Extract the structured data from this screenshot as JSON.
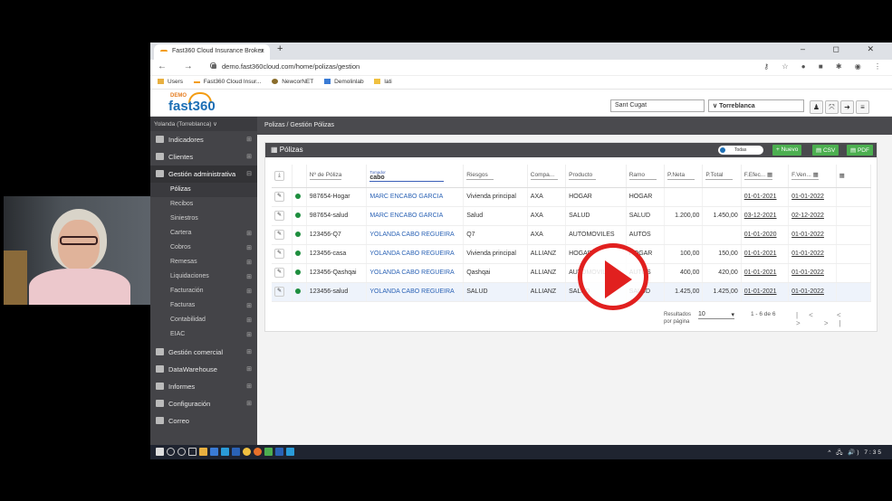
{
  "browser": {
    "tab_title": "Fast360 Cloud Insurance Broker",
    "tab_close": "×",
    "new_tab": "+",
    "window_controls": "– ◻ ✕",
    "nav": "← → C",
    "url": "demo.fast360cloud.com/home/polizas/gestion",
    "icons": "⚷ ☆ ● ■ ✱ ◉ ⋮",
    "bookmarks": [
      "Users",
      "Fast360 Cloud Insur...",
      "NewcorNET",
      "Demolinlab",
      "lati"
    ]
  },
  "header": {
    "logo_demo": "DEMO",
    "logo_text": "fast360",
    "office": "Sant Cugat",
    "branch": "Torreblanca",
    "branch_chevron": "∨",
    "buttons": [
      "♟",
      "⤧",
      "➜",
      "≡"
    ]
  },
  "sidebar": {
    "user": "Yolanda (Torreblanca)  ∨",
    "items": [
      {
        "label": "Indicadores",
        "expander": "⊞"
      },
      {
        "label": "Clientes",
        "expander": "⊞"
      },
      {
        "label": "Gestión administrativa",
        "expander": "⊟"
      }
    ],
    "subitems": [
      {
        "label": "Pólizas",
        "expander": ""
      },
      {
        "label": "Recibos",
        "expander": ""
      },
      {
        "label": "Siniestros",
        "expander": ""
      },
      {
        "label": "Cartera",
        "expander": "⊞"
      },
      {
        "label": "Cobros",
        "expander": "⊞"
      },
      {
        "label": "Remesas",
        "expander": "⊞"
      },
      {
        "label": "Liquidaciones",
        "expander": "⊞"
      },
      {
        "label": "Facturación",
        "expander": "⊞"
      },
      {
        "label": "Facturas",
        "expander": "⊞"
      },
      {
        "label": "Contabilidad",
        "expander": "⊞"
      },
      {
        "label": "EIAC",
        "expander": "⊞"
      }
    ],
    "bottom_items": [
      {
        "label": "Gestión comercial",
        "expander": "⊞"
      },
      {
        "label": "DataWarehouse",
        "expander": "⊞"
      },
      {
        "label": "Informes",
        "expander": "⊞"
      },
      {
        "label": "Configuración",
        "expander": "⊞"
      },
      {
        "label": "Correo",
        "expander": ""
      }
    ]
  },
  "breadcrumb": "Polizas  /  Gestión Pólizas",
  "panel": {
    "title": "Pólizas",
    "toggle_label": "Todas",
    "btn_new": "+ Nuevo",
    "btn_csv": "CSV",
    "btn_pdf": "PDF"
  },
  "table": {
    "headers": {
      "policy": "Nº de Póliza",
      "tomador_small": "Tomador",
      "tomador_filter": "cabo",
      "risks": "Riesgos",
      "company": "Compa...",
      "product": "Producto",
      "branch": "Ramo",
      "net": "P.Neta",
      "total": "P.Total",
      "start": "F.Efec...",
      "end": "F.Ven...",
      "download": "⤓",
      "calendar": "▦"
    },
    "edit_icon": "✎",
    "rows": [
      {
        "policy": "987654-Hogar",
        "tomador": "MARC ENCABO GARCIA",
        "risk": "Vivienda principal",
        "company": "AXA",
        "product": "HOGAR",
        "branch": "HOGAR",
        "net": "",
        "total": "",
        "start": "01-01-2021",
        "end": "01-01-2022"
      },
      {
        "policy": "987654-salud",
        "tomador": "MARC ENCABO GARCIA",
        "risk": "Salud",
        "company": "AXA",
        "product": "SALUD",
        "branch": "SALUD",
        "net": "1.200,00",
        "total": "1.450,00",
        "start": "03-12-2021",
        "end": "02-12-2022"
      },
      {
        "policy": "123456-Q7",
        "tomador": "YOLANDA CABO REGUEIRA",
        "risk": "Q7",
        "company": "AXA",
        "product": "AUTOMOVILES",
        "branch": "AUTOS",
        "net": "",
        "total": "",
        "start": "01-01-2020",
        "end": "01-01-2022"
      },
      {
        "policy": "123456-casa",
        "tomador": "YOLANDA CABO REGUEIRA",
        "risk": "Vivienda principal",
        "company": "ALLIANZ",
        "product": "HOGAR",
        "branch": "HOGAR",
        "net": "100,00",
        "total": "150,00",
        "start": "01-01-2021",
        "end": "01-01-2022"
      },
      {
        "policy": "123456-Qashqai",
        "tomador": "YOLANDA CABO REGUEIRA",
        "risk": "Qashqai",
        "company": "ALLIANZ",
        "product": "AUTOMOVILES",
        "branch": "AUTOS",
        "net": "400,00",
        "total": "420,00",
        "start": "01-01-2021",
        "end": "01-01-2022"
      },
      {
        "policy": "123456-salud",
        "tomador": "YOLANDA CABO REGUEIRA",
        "risk": "SALUD",
        "company": "ALLIANZ",
        "product": "SALUD",
        "branch": "SALUD",
        "net": "1.425,00",
        "total": "1.425,00",
        "start": "01-01-2021",
        "end": "01-01-2022"
      }
    ]
  },
  "pager": {
    "per_page_label": "Resultados por página",
    "per_page_value": "10",
    "range": "1 - 6 de 6",
    "nav": "|< < > >|"
  },
  "taskbar": {
    "tray": "^ 🖧 🔊) 7:35"
  },
  "colors": {
    "accent": "#1d6fb5",
    "sidebar": "#444448",
    "header_bar": "#4a4a4e",
    "green": "#4caf50",
    "play_red": "#e1201f"
  }
}
